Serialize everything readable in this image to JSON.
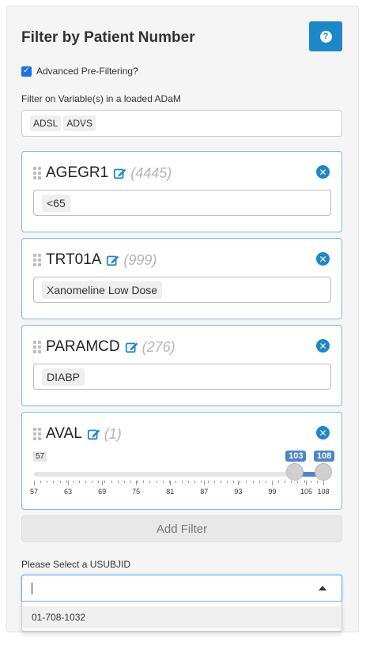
{
  "panel": {
    "title": "Filter by Patient Number"
  },
  "help_button": {
    "icon": "question-icon",
    "glyph": "?"
  },
  "advanced": {
    "label": "Advanced Pre-Filtering?",
    "checked": true
  },
  "variables": {
    "label": "Filter on Variable(s) in a loaded ADaM",
    "selected": [
      "ADSL",
      "ADVS"
    ]
  },
  "filters": [
    {
      "name": "AGEGR1",
      "count": "(4445)",
      "type": "select",
      "values": [
        "<65"
      ]
    },
    {
      "name": "TRT01A",
      "count": "(999)",
      "type": "select",
      "values": [
        "Xanomeline Low Dose"
      ]
    },
    {
      "name": "PARAMCD",
      "count": "(276)",
      "type": "select",
      "values": [
        "DIABP"
      ]
    },
    {
      "name": "AVAL",
      "count": "(1)",
      "type": "range",
      "min_label": "57",
      "min": 57,
      "max": 108,
      "low_value": 103,
      "high_value": 108,
      "low_label": "103",
      "high_label": "108",
      "ticks": [
        "57",
        "63",
        "69",
        "75",
        "81",
        "87",
        "93",
        "99",
        "105",
        "108"
      ]
    }
  ],
  "add_filter": {
    "label": "Add Filter"
  },
  "usubjid": {
    "label": "Please Select a USUBJID",
    "value": "",
    "options": [
      "01-708-1032"
    ]
  },
  "colors": {
    "accent": "#1c87c9",
    "slider_fill": "#4a86c5",
    "card_border": "#7fb8e0"
  }
}
